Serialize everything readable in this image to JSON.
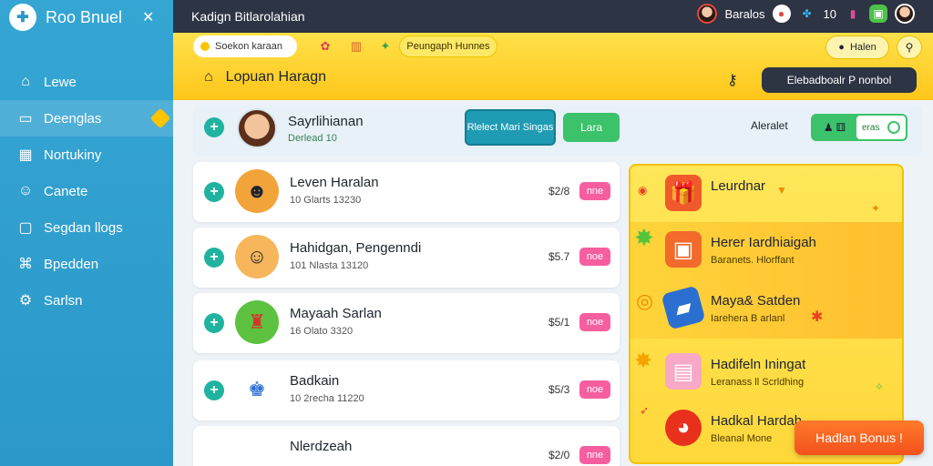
{
  "sidebar": {
    "brand": "Roo Bnuel",
    "items": [
      {
        "label": "Lewe",
        "icon": "home-icon"
      },
      {
        "label": "Deenglas",
        "icon": "card-icon"
      },
      {
        "label": "Nortukiny",
        "icon": "calendar-icon"
      },
      {
        "label": "Canete",
        "icon": "user-icon"
      },
      {
        "label": "Segdan llogs",
        "icon": "chat-icon"
      },
      {
        "label": "Bpedden",
        "icon": "gift-icon"
      },
      {
        "label": "Sarlsn",
        "icon": "gear-icon"
      }
    ]
  },
  "topbar": {
    "title": "Kadign Bitlarolahian",
    "user": "Baralos",
    "count": "10"
  },
  "banner": {
    "search_placeholder": "Soekon karaan",
    "promo": "Peungaph Hunnes",
    "right_pill": "Halen",
    "home_label": "Lopuan Haragn",
    "dash_button": "Elebadboalr P nonbol"
  },
  "profile": {
    "name": "Sayrlihianan",
    "sub": "Derlead 10",
    "select_button": "Rlelect Mari Singas",
    "green_button": "Lara",
    "right_label": "Aleralet",
    "toggle_label": "eras"
  },
  "list": [
    {
      "title": "Leven Haralan",
      "sub": "10 Glarts 13230",
      "price": "$2/8",
      "tag": "nne"
    },
    {
      "title": "Hahidgan, Pengenndi",
      "sub": "101 Nlasta 13120",
      "price": "$5.7",
      "tag": "noe"
    },
    {
      "title": "Mayaah Sarlan",
      "sub": "16 Olato 3320",
      "price": "$5/1",
      "tag": "noe"
    },
    {
      "title": "Badkain",
      "sub": "10 2recha 11220",
      "price": "$5/3",
      "tag": "noe"
    },
    {
      "title": "Nlerdzeah",
      "sub": "",
      "price": "$2/0",
      "tag": "nne"
    }
  ],
  "rewards": [
    {
      "title": "Leurdnar",
      "sub": ""
    },
    {
      "title": "Herer Iardhiaigah",
      "sub": "Baranets. Hlorffant"
    },
    {
      "title": "Maya& Satden",
      "sub": "Iarehera B arlanl"
    },
    {
      "title": "Hadifeln Iningat",
      "sub": "Leranass ll Scrldhing"
    },
    {
      "title": "Hadkal Hardah",
      "sub": "Bleanal Mone"
    }
  ],
  "bonus_button": "Hadlan Bonus !"
}
